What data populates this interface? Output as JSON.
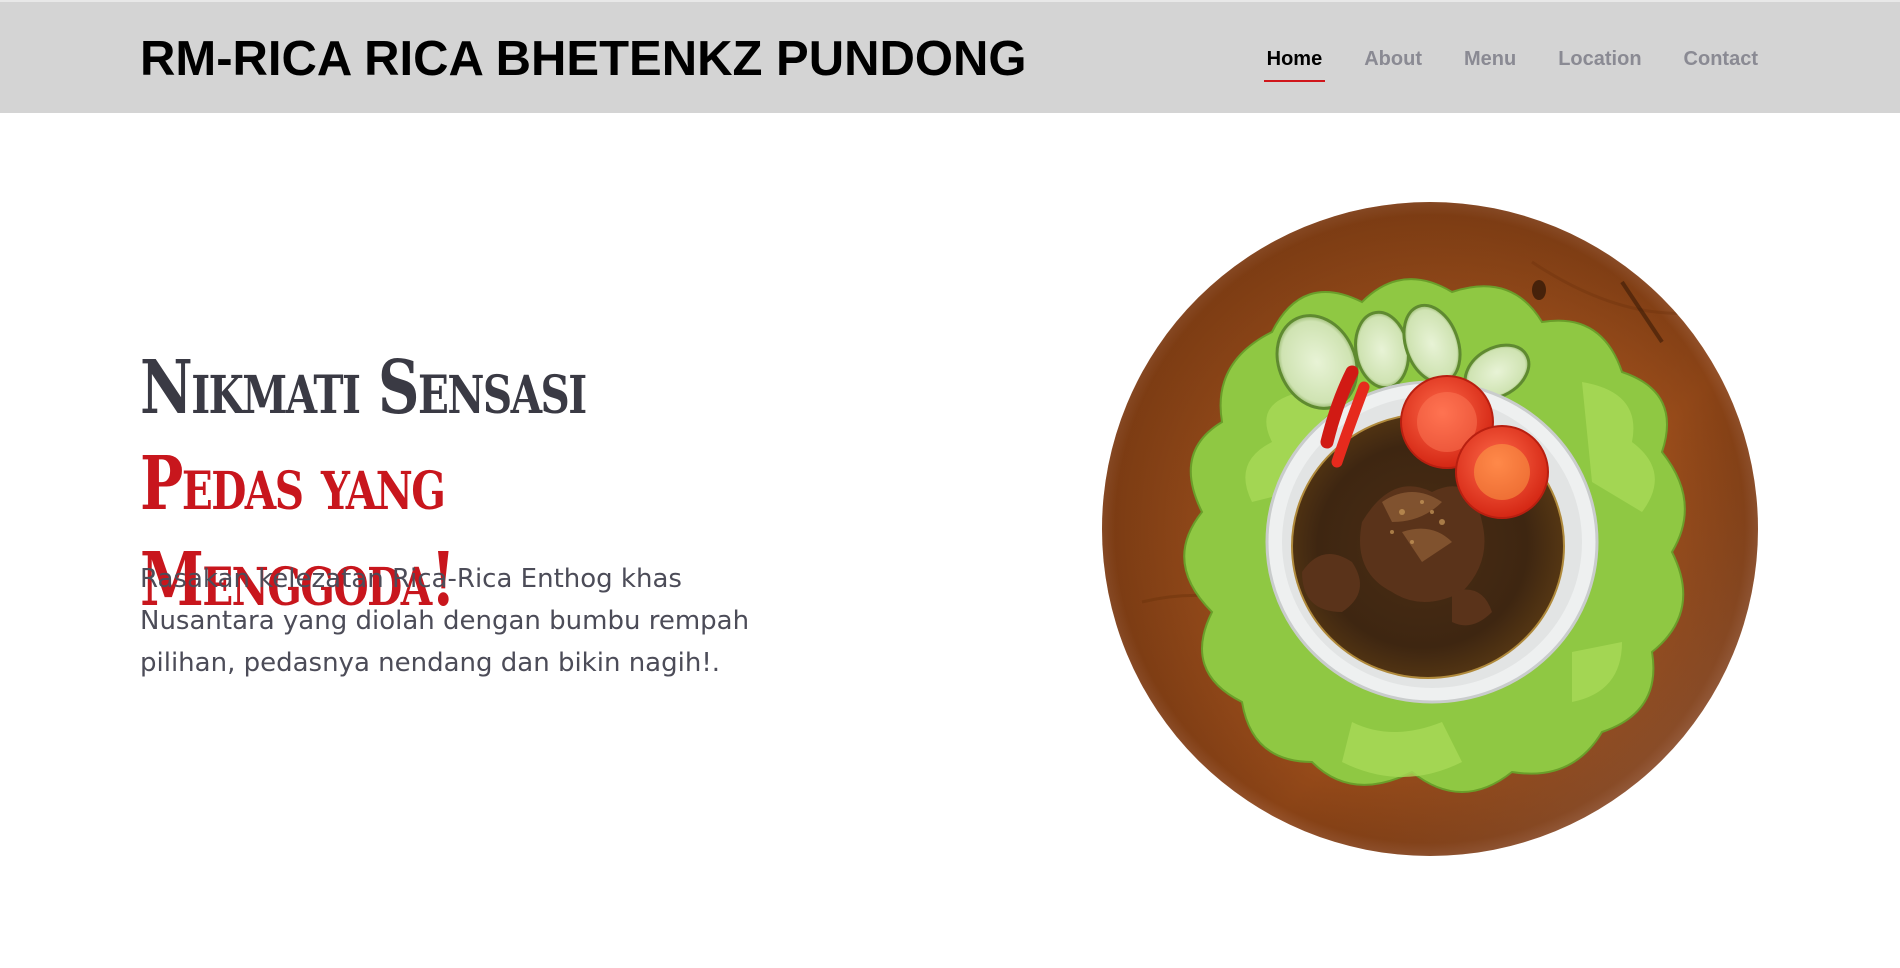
{
  "header": {
    "brand": "RM-RICA RICA BHETENKZ PUNDONG",
    "nav": [
      {
        "label": "Home",
        "active": true
      },
      {
        "label": "About",
        "active": false
      },
      {
        "label": "Menu",
        "active": false
      },
      {
        "label": "Location",
        "active": false
      },
      {
        "label": "Contact",
        "active": false
      }
    ]
  },
  "hero": {
    "title_plain": "Nikmati Sensasi ",
    "title_accent": "Pedas yang Menggoda!",
    "description": "Rasakan kelezatan Rica-Rica Enthog khas Nusantara yang diolah dengan bumbu rempah pilihan, pedasnya nendang dan bikin nagih!."
  },
  "colors": {
    "header_bg": "#d4d4d4",
    "accent": "#c8161d",
    "nav_inactive": "#8a8a93",
    "title_text": "#3a3a44",
    "body_text": "#4c4c58"
  },
  "image": {
    "icon": "rica-rica-dish-photo"
  }
}
